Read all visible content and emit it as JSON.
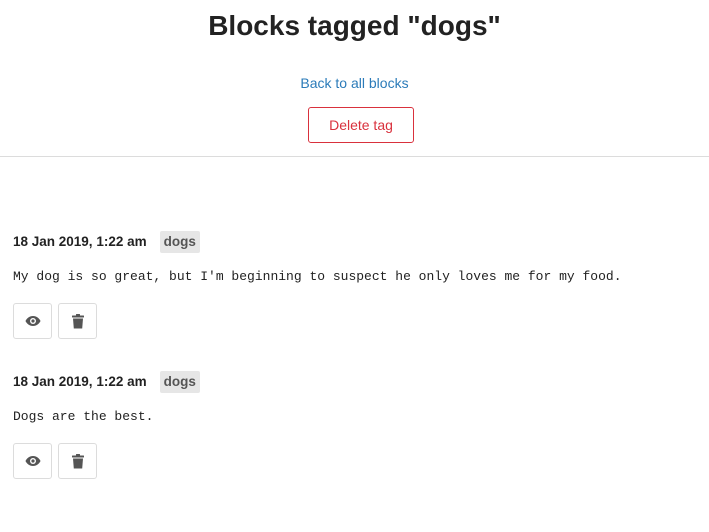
{
  "page": {
    "title": "Blocks tagged \"dogs\"",
    "back_link": "Back to all blocks",
    "delete_tag_label": "Delete tag"
  },
  "colors": {
    "link": "#2b7bb9",
    "danger": "#d9313d",
    "tag_bg": "#e6e6e6",
    "icon": "#555555"
  },
  "blocks": [
    {
      "timestamp": "18 Jan 2019, 1:22 am",
      "tag": "dogs",
      "content": "My dog is so great, but I'm beginning to suspect he only loves me for my food.",
      "actions": [
        {
          "icon": "eye-icon",
          "name": "view-button"
        },
        {
          "icon": "trash-icon",
          "name": "delete-button"
        }
      ]
    },
    {
      "timestamp": "18 Jan 2019, 1:22 am",
      "tag": "dogs",
      "content": "Dogs are the best.",
      "actions": [
        {
          "icon": "eye-icon",
          "name": "view-button"
        },
        {
          "icon": "trash-icon",
          "name": "delete-button"
        }
      ]
    }
  ]
}
